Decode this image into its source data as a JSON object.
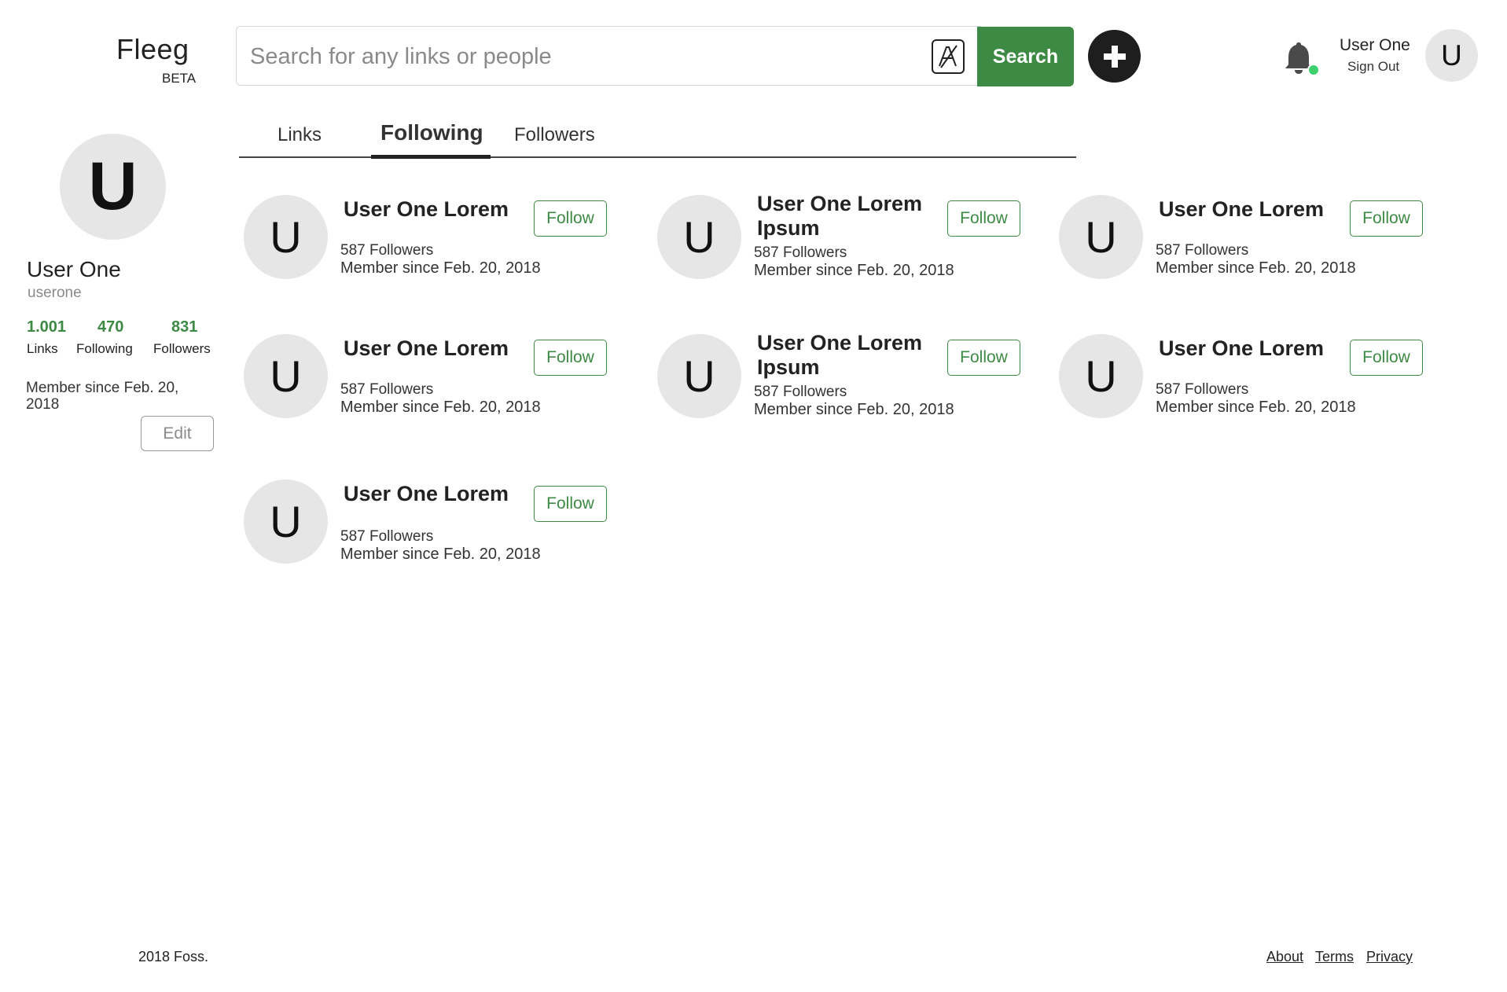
{
  "header": {
    "logo": "Fleeg",
    "beta": "BETA",
    "search_placeholder": "Search for any links or people",
    "search_value": "",
    "lang_icon": "translate-icon",
    "search_label": "Search",
    "add_icon": "plus-icon",
    "bell_icon": "bell-icon",
    "user_name": "User One",
    "sign_out": "Sign Out",
    "avatar_initial": "U"
  },
  "profile": {
    "avatar_initial": "U",
    "name": "User One",
    "username": "userone",
    "stats": [
      {
        "value": "1.001",
        "label": "Links"
      },
      {
        "value": "470",
        "label": "Following"
      },
      {
        "value": "831",
        "label": "Followers"
      }
    ],
    "member_since": "Member since Feb. 20, 2018",
    "edit_label": "Edit"
  },
  "tabs": [
    {
      "label": "Links",
      "active": false
    },
    {
      "label": "Following",
      "active": true
    },
    {
      "label": "Followers",
      "active": false
    }
  ],
  "users": [
    {
      "initial": "U",
      "name": "User One Lorem",
      "followers": "587 Followers",
      "since": "Member since Feb. 20, 2018",
      "follow_label": "Follow"
    },
    {
      "initial": "U",
      "name": "User One Lorem Ipsum",
      "followers": "587 Followers",
      "since": "Member since Feb. 20, 2018",
      "follow_label": "Follow"
    },
    {
      "initial": "U",
      "name": "User One Lorem",
      "followers": "587 Followers",
      "since": "Member since Feb. 20, 2018",
      "follow_label": "Follow"
    },
    {
      "initial": "U",
      "name": "User One Lorem",
      "followers": "587 Followers",
      "since": "Member since Feb. 20, 2018",
      "follow_label": "Follow"
    },
    {
      "initial": "U",
      "name": "User One Lorem Ipsum",
      "followers": "587 Followers",
      "since": "Member since Feb. 20, 2018",
      "follow_label": "Follow"
    },
    {
      "initial": "U",
      "name": "User One Lorem",
      "followers": "587 Followers",
      "since": "Member since Feb. 20, 2018",
      "follow_label": "Follow"
    },
    {
      "initial": "U",
      "name": "User One Lorem",
      "followers": "587 Followers",
      "since": "Member since Feb. 20, 2018",
      "follow_label": "Follow"
    }
  ],
  "footer": {
    "copyright": "2018 Foss.",
    "links": [
      "About",
      "Terms",
      "Privacy"
    ]
  },
  "colors": {
    "accent": "#3d8a44",
    "avatar_bg": "#e6e6e6",
    "online_dot": "#3dd16e"
  }
}
